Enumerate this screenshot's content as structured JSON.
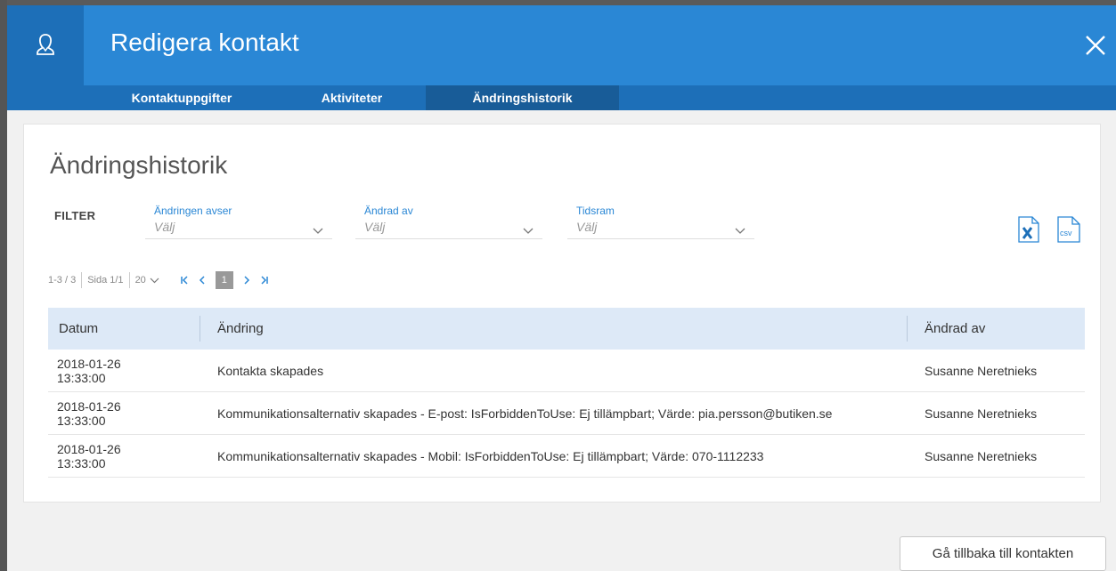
{
  "header": {
    "title": "Redigera kontakt",
    "icon": "contact-person-icon",
    "close_icon": "close-icon"
  },
  "tabs": [
    {
      "label": "Kontaktuppgifter",
      "active": false
    },
    {
      "label": "Aktiviteter",
      "active": false
    },
    {
      "label": "Ändringshistorik",
      "active": true
    }
  ],
  "section_title": "Ändringshistorik",
  "filter": {
    "label": "FILTER",
    "fields": [
      {
        "caption": "Ändringen avser",
        "value": "Välj"
      },
      {
        "caption": "Ändrad av",
        "value": "Välj"
      },
      {
        "caption": "Tidsram",
        "value": "Välj"
      }
    ]
  },
  "export": {
    "excel_icon": "excel-export-icon",
    "csv_label": "csv"
  },
  "pager": {
    "range": "1-3 / 3",
    "page_info": "Sida 1/1",
    "page_size": "20",
    "current_page": "1"
  },
  "table": {
    "columns": [
      "Datum",
      "Ändring",
      "Ändrad av"
    ],
    "rows": [
      {
        "date": "2018-01-26 13:33:00",
        "change": "Kontakta skapades",
        "by": "Susanne Neretnieks"
      },
      {
        "date": "2018-01-26 13:33:00",
        "change": "Kommunikationsalternativ skapades - E-post: IsForbiddenToUse: Ej tillämpbart; Värde: pia.persson@butiken.se",
        "by": "Susanne Neretnieks"
      },
      {
        "date": "2018-01-26 13:33:00",
        "change": "Kommunikationsalternativ skapades - Mobil: IsForbiddenToUse: Ej tillämpbart; Värde: 070-1112233",
        "by": "Susanne Neretnieks"
      }
    ]
  },
  "footer": {
    "back_label": "Gå tillbaka till kontakten"
  },
  "colors": {
    "header_blue": "#2a87d5",
    "tab_bar_blue": "#1d6fb8",
    "active_tab": "#185c98",
    "table_header": "#dde9f7"
  }
}
